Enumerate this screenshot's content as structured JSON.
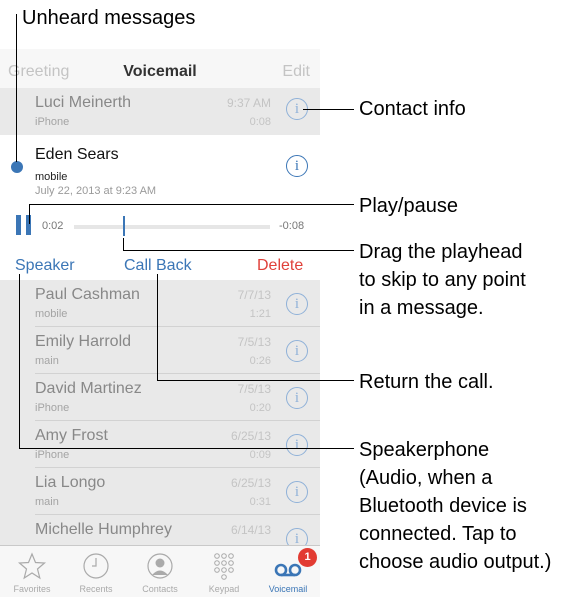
{
  "callouts": {
    "unheard": "Unheard messages",
    "contact_info": "Contact info",
    "play_pause": "Play/pause",
    "drag_playhead": [
      "Drag the playhead",
      "to skip to any point",
      "in a message."
    ],
    "return_call": "Return the call.",
    "speakerphone": [
      "Speakerphone",
      "(Audio, when a",
      "Bluetooth device is",
      "connected. Tap to",
      "choose audio output.)"
    ]
  },
  "navbar": {
    "left": "Greeting",
    "title": "Voicemail",
    "right": "Edit"
  },
  "top_row": {
    "name": "Luci Meinerth",
    "label": "iPhone",
    "time": "9:37 AM",
    "duration": "0:08"
  },
  "expanded": {
    "name": "Eden Sears",
    "label": "mobile",
    "date": "July 22, 2013 at 9:23 AM",
    "elapsed": "0:02",
    "remaining": "-0:08",
    "playhead_fraction": 0.25,
    "speaker": "Speaker",
    "call_back": "Call Back",
    "delete": "Delete"
  },
  "rows": [
    {
      "name": "Paul Cashman",
      "label": "mobile",
      "date": "7/7/13",
      "duration": "1:21"
    },
    {
      "name": "Emily Harrold",
      "label": "main",
      "date": "7/5/13",
      "duration": "0:26"
    },
    {
      "name": "David Martinez",
      "label": "iPhone",
      "date": "7/5/13",
      "duration": "0:20"
    },
    {
      "name": "Amy Frost",
      "label": "iPhone",
      "date": "6/25/13",
      "duration": "0:09"
    },
    {
      "name": "Lia Longo",
      "label": "main",
      "date": "6/25/13",
      "duration": "0:31"
    },
    {
      "name": "Michelle Humphrey",
      "label": "",
      "date": "6/14/13",
      "duration": ""
    }
  ],
  "tabs": [
    {
      "label": "Favorites",
      "icon": "star-icon"
    },
    {
      "label": "Recents",
      "icon": "clock-icon"
    },
    {
      "label": "Contacts",
      "icon": "person-icon"
    },
    {
      "label": "Keypad",
      "icon": "keypad-icon"
    },
    {
      "label": "Voicemail",
      "icon": "voicemail-icon",
      "badge": "1"
    }
  ],
  "colors": {
    "accent": "#3b76b6",
    "delete": "#e0413a",
    "badge": "#e23b32",
    "info": "#8fb1d8"
  }
}
